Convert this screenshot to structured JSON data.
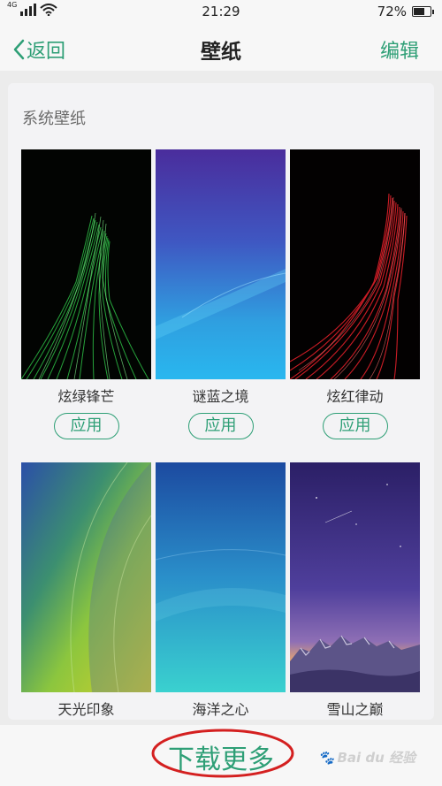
{
  "status_bar": {
    "network": "4G",
    "time": "21:29",
    "battery_text": "72%",
    "battery_level": 0.72
  },
  "nav": {
    "back_label": "返回",
    "title": "壁纸",
    "edit_label": "编辑"
  },
  "section": {
    "title": "系统壁纸"
  },
  "wallpapers": [
    {
      "name": "炫绿锋芒",
      "apply_label": "应用"
    },
    {
      "name": "谜蓝之境",
      "apply_label": "应用"
    },
    {
      "name": "炫红律动",
      "apply_label": "应用"
    },
    {
      "name": "天光印象"
    },
    {
      "name": "海洋之心"
    },
    {
      "name": "雪山之巅"
    }
  ],
  "bottom": {
    "download_label": "下载更多",
    "watermark": "Bai du 经验"
  },
  "colors": {
    "accent": "#2e9f76",
    "annotation_circle": "#d42020"
  }
}
